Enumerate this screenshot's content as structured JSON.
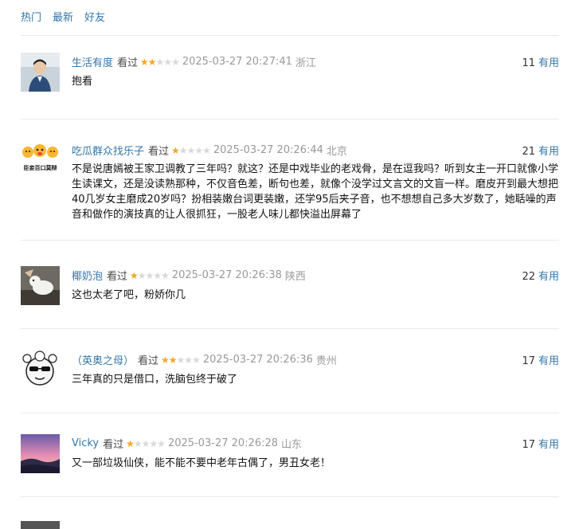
{
  "tabs": [
    "热门",
    "最新",
    "好友"
  ],
  "useful_label": "有用",
  "watched_label": "看过",
  "colors": {
    "link": "#3377aa",
    "star": "#f6a623",
    "star_empty": "#d8d8d8",
    "muted": "#999999"
  },
  "comments": [
    {
      "user": "生活有度",
      "rating": 2,
      "time": "2025-03-27 20:27:41",
      "location": "浙江",
      "votes": "11",
      "text": "抱看"
    },
    {
      "user": "吃瓜群众找乐子",
      "rating": 1,
      "time": "2025-03-27 20:26:44",
      "location": "北京",
      "votes": "21",
      "text": "不是说唐嫣被王家卫调教了三年吗？就这？还是中戏毕业的老戏骨，是在逗我吗？听到女主一开口就像小学生读课文，还是没读熟那种，不仅音色差，断句也差，就像个没学过文言文的文盲一样。磨皮开到最大想把40几岁女主磨成20岁吗？扮相装嫩台词更装嫩，还学95后夹子音，也不想想自己多大岁数了，她聒噪的声音和做作的演技真的让人很抓狂，一股老人味儿都快溢出屏幕了"
    },
    {
      "user": "椰奶泡",
      "rating": 1,
      "time": "2025-03-27 20:26:38",
      "location": "陕西",
      "votes": "22",
      "text": "这也太老了吧，粉娇你几"
    },
    {
      "user": "（英奥之母）",
      "rating": 2,
      "time": "2025-03-27 20:26:36",
      "location": "贵州",
      "votes": "17",
      "text": "三年真的只是借口，洗脑包终于破了"
    },
    {
      "user": "Vicky",
      "rating": 1,
      "time": "2025-03-27 20:26:28",
      "location": "山东",
      "votes": "17",
      "text": "又一部垃圾仙侠，能不能不要中老年古偶了，男丑女老！"
    }
  ],
  "avatar_text_2": "臣妾百口莫辩"
}
